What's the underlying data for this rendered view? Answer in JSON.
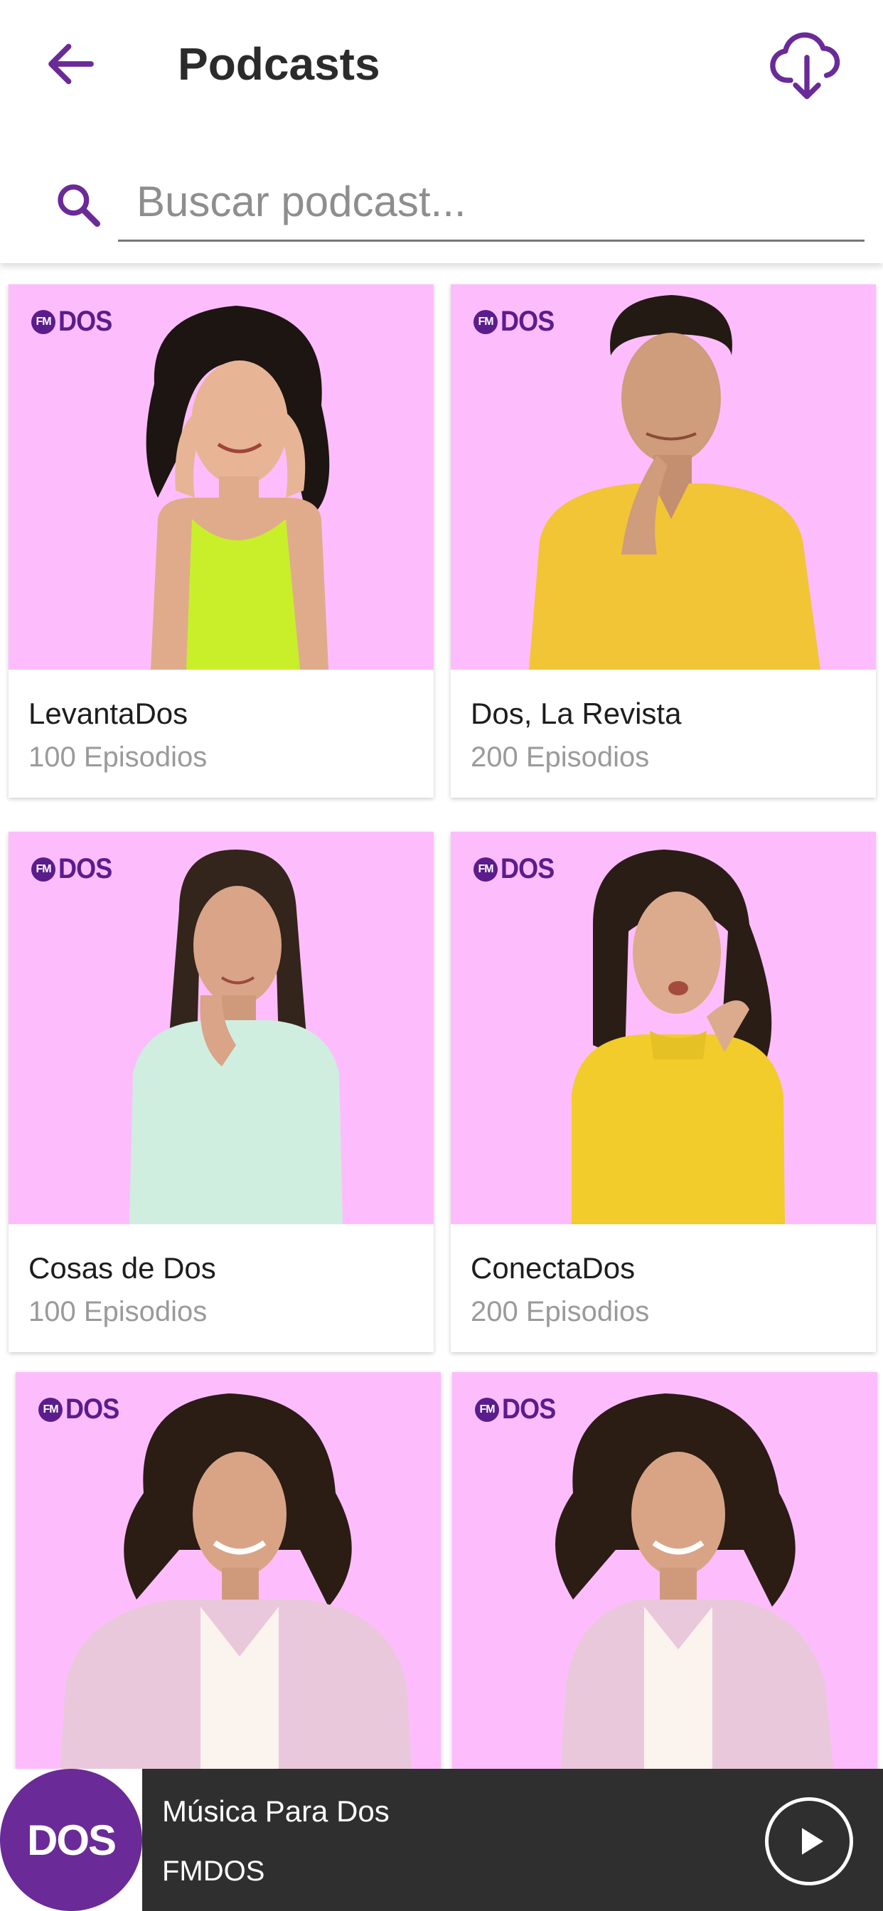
{
  "header": {
    "title": "Podcasts",
    "back_icon": "arrow-left-icon",
    "download_icon": "cloud-download-icon",
    "accent": "#6a2a98"
  },
  "search": {
    "placeholder": "Buscar podcast...",
    "value": "",
    "icon": "search-icon"
  },
  "podcasts": [
    {
      "name": "LevantaDos",
      "episodes": "100 Episodios",
      "logo_fm": "FM",
      "logo_text": "DOS",
      "cover_color": "#fdbdfc"
    },
    {
      "name": "Dos, La Revista",
      "episodes": "200 Episodios",
      "logo_fm": "FM",
      "logo_text": "DOS",
      "cover_color": "#fdbdfc"
    },
    {
      "name": "Cosas de Dos",
      "episodes": "100 Episodios",
      "logo_fm": "FM",
      "logo_text": "DOS",
      "cover_color": "#fdbdfc"
    },
    {
      "name": "ConectaDos",
      "episodes": "200 Episodios",
      "logo_fm": "FM",
      "logo_text": "DOS",
      "cover_color": "#fdbdfc"
    },
    {
      "name": "",
      "episodes": "",
      "logo_fm": "FM",
      "logo_text": "DOS",
      "cover_color": "#fdbdfc"
    },
    {
      "name": "",
      "episodes": "",
      "logo_fm": "FM",
      "logo_text": "DOS",
      "cover_color": "#fdbdfc"
    }
  ],
  "player": {
    "logo_text": "DOS",
    "title": "Música Para Dos",
    "subtitle": "FMDOS",
    "play_icon": "play-icon",
    "background": "#2f2f2f"
  }
}
